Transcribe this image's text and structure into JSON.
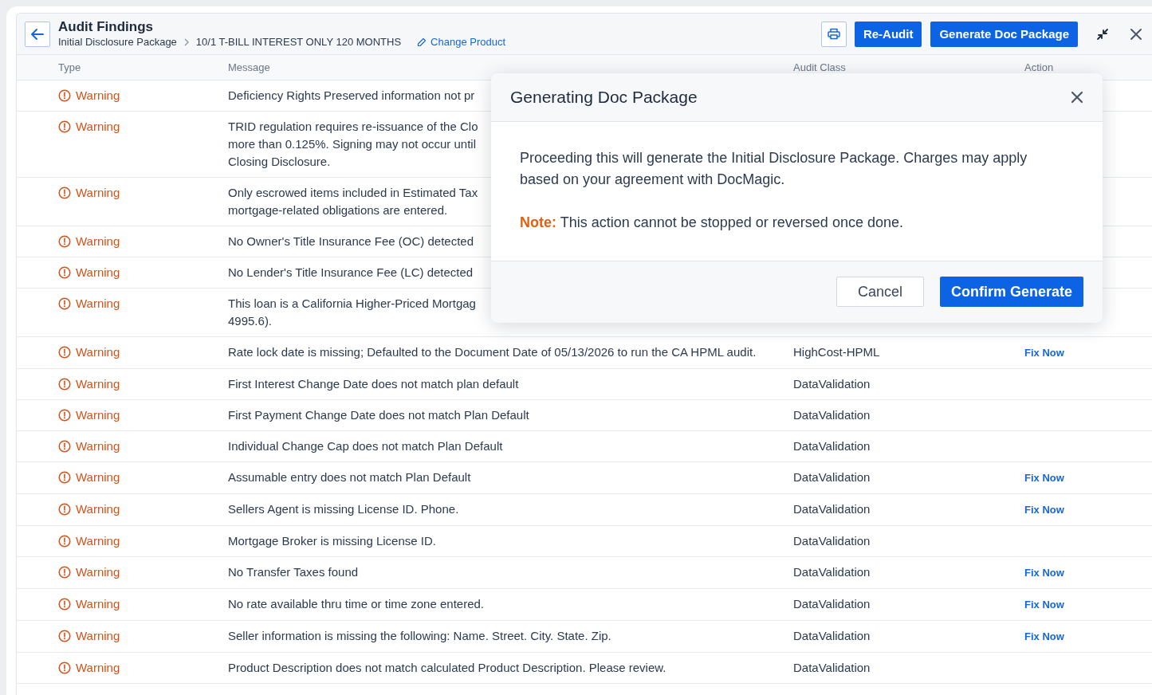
{
  "header": {
    "title": "Audit Findings",
    "breadcrumb": [
      "Initial Disclosure Package",
      "10/1 T-BILL INTEREST ONLY 120 MONTHS"
    ],
    "change_link": "Change Product",
    "buttons": [
      {
        "label": "Re-Audit"
      },
      {
        "label": "Generate Doc Package"
      }
    ]
  },
  "table": {
    "columns": [
      "Type",
      "Message",
      "Audit Class",
      "Action"
    ],
    "rows": [
      {
        "type": "Warning",
        "message": "Deficiency Rights Preserved information not pr"
      },
      {
        "type": "Warning",
        "message": "TRID regulation requires re-issuance of the Clo\nmore than 0.125%. Signing may not occur until\nClosing Disclosure."
      },
      {
        "type": "Warning",
        "message": "Only escrowed items included in Estimated Tax\nmortgage-related obligations are entered."
      },
      {
        "type": "Warning",
        "message": "No Owner's Title Insurance Fee (OC) detected"
      },
      {
        "type": "Warning",
        "message": "No Lender's Title Insurance Fee (LC) detected"
      },
      {
        "type": "Warning",
        "message": "This loan is a California Higher-Priced Mortgag\n4995.6)."
      },
      {
        "type": "Warning",
        "message": "Rate lock date is missing; Defaulted to the Document Date of 05/13/2026 to run the CA HPML audit.",
        "audit_class": "HighCost-HPML",
        "action": "Fix Now"
      },
      {
        "type": "Warning",
        "message": "First Interest Change Date does not match plan default",
        "audit_class": "DataValidation"
      },
      {
        "type": "Warning",
        "message": "First Payment Change Date does not match Plan Default",
        "audit_class": "DataValidation"
      },
      {
        "type": "Warning",
        "message": "Individual Change Cap does not match Plan Default",
        "audit_class": "DataValidation"
      },
      {
        "type": "Warning",
        "message": "Assumable entry does not match Plan Default",
        "audit_class": "DataValidation",
        "action": "Fix Now"
      },
      {
        "type": "Warning",
        "message": "Sellers Agent is missing License ID. Phone.",
        "audit_class": "DataValidation",
        "action": "Fix Now"
      },
      {
        "type": "Warning",
        "message": "Mortgage Broker is missing License ID.",
        "audit_class": "DataValidation"
      },
      {
        "type": "Warning",
        "message": "No Transfer Taxes found",
        "audit_class": "DataValidation",
        "action": "Fix Now"
      },
      {
        "type": "Warning",
        "message": "No rate available thru time or time zone entered.",
        "audit_class": "DataValidation",
        "action": "Fix Now"
      },
      {
        "type": "Warning",
        "message": "Seller information is missing the following: Name. Street. City. State. Zip.",
        "audit_class": "DataValidation",
        "action": "Fix Now"
      },
      {
        "type": "Warning",
        "message": "Product Description does not match calculated Product Description. Please review.",
        "audit_class": "DataValidation"
      }
    ]
  },
  "modal": {
    "title": "Generating Doc Package",
    "body": "Proceeding this will generate the Initial Disclosure Package. Charges may apply based on your agreement with DocMagic.",
    "note": "**Note:** This action cannot be stopped or reversed once done.",
    "buttons": [
      {
        "label": "Cancel",
        "kind": "secondary"
      },
      {
        "label": "Confirm Generate",
        "kind": "primary"
      }
    ]
  }
}
